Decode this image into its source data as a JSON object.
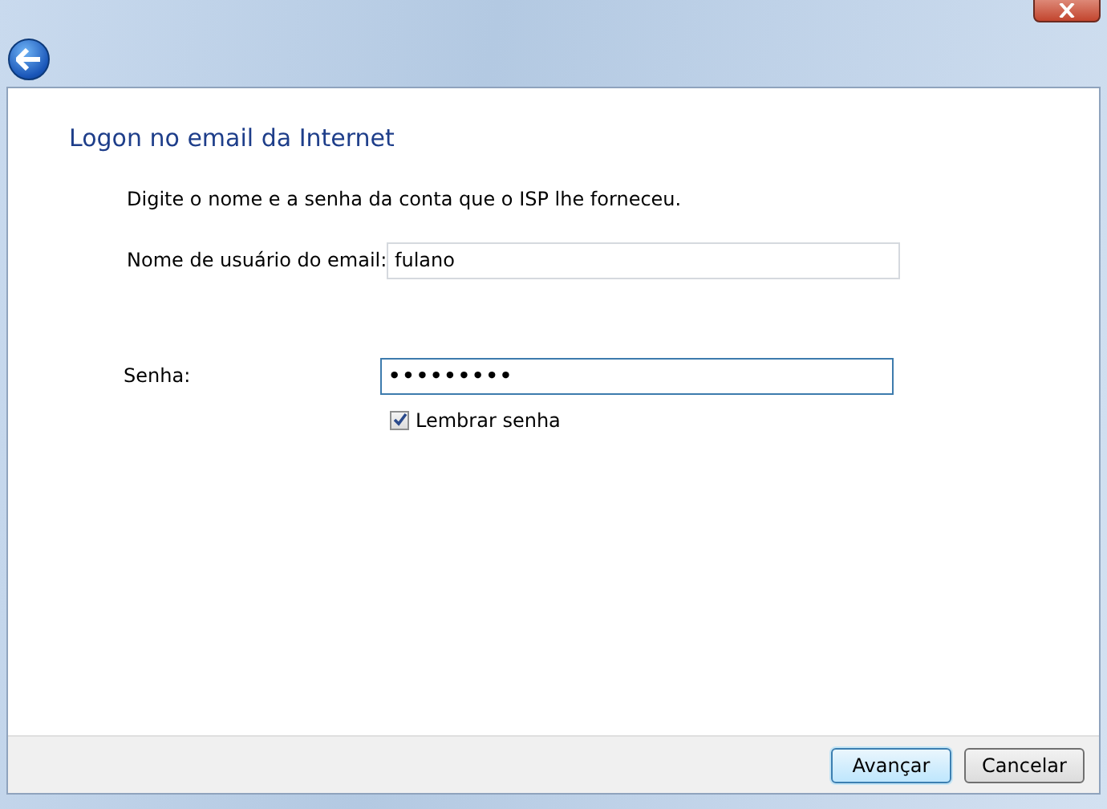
{
  "heading": "Logon no email da Internet",
  "instruction": "Digite o nome e a senha da conta que o ISP lhe forneceu.",
  "fields": [
    {
      "label": "Nome de usuário do email:",
      "value": "fulano",
      "focused": false
    },
    {
      "label": "Senha:",
      "value": "•••••••••",
      "focused": true
    }
  ],
  "remember": {
    "label": "Lembrar senha",
    "checked": true
  },
  "buttons": [
    {
      "label": "Avançar",
      "default": true
    },
    {
      "label": "Cancelar",
      "default": false
    }
  ]
}
